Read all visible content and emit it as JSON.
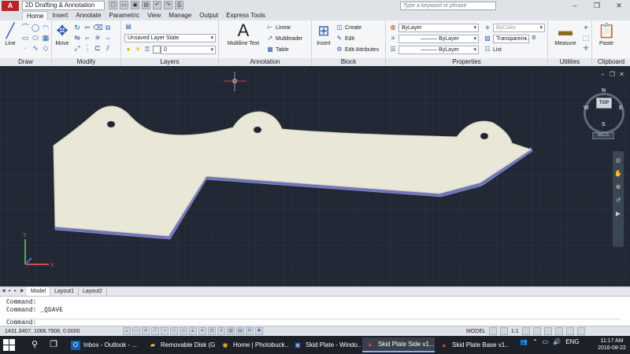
{
  "title_bar": {
    "app_logo": "A",
    "workspace": "2D Drafting & Annotation",
    "search_placeholder": "Type a keyword or phrase",
    "window_buttons": [
      "–",
      "❐",
      "✕"
    ]
  },
  "tabs": [
    {
      "label": "Home",
      "active": true
    },
    {
      "label": "Insert"
    },
    {
      "label": "Annotate"
    },
    {
      "label": "Parametric"
    },
    {
      "label": "View"
    },
    {
      "label": "Manage"
    },
    {
      "label": "Output"
    },
    {
      "label": "Express Tools"
    }
  ],
  "ribbon": {
    "draw": {
      "title": "Draw",
      "line_label": "Line"
    },
    "modify": {
      "title": "Modify",
      "move_label": "Move"
    },
    "layers": {
      "title": "Layers",
      "layer_state": "Unsaved Layer State",
      "current_layer": "0"
    },
    "annotation": {
      "title": "Annotation",
      "multiline_text": "Multiline Text",
      "linear": "Linear",
      "multileader": "Multileader",
      "table": "Table"
    },
    "block": {
      "title": "Block",
      "insert": "Insert",
      "create": "Create",
      "edit": "Edit",
      "edit_attributes": "Edit Attributes"
    },
    "properties": {
      "title": "Properties",
      "color": "ByLayer",
      "linetype": "ByLayer",
      "lineweight": "ByLayer",
      "plot_style": "ByColor",
      "transparency": "Transparen...",
      "transparency_value": "0",
      "list": "List"
    },
    "utilities": {
      "title": "Utilities",
      "measure": "Measure"
    },
    "clipboard": {
      "title": "Clipboard",
      "paste": "Paste"
    }
  },
  "viewcube": {
    "top": "TOP",
    "north": "N",
    "south": "S",
    "east": "E",
    "west": "W",
    "wcs": "WCS"
  },
  "layout_tabs": [
    {
      "label": "Model",
      "active": true
    },
    {
      "label": "Layout1"
    },
    {
      "label": "Layout2"
    }
  ],
  "command_window": {
    "history": [
      "Command:",
      "Command: _QSAVE"
    ],
    "prompt": "Command:"
  },
  "status_bar": {
    "coordinates": "1431.3407, 1066.7908, 0.0000",
    "model_label": "MODEL",
    "scale": "1:1"
  },
  "taskbar": {
    "items": [
      {
        "label": "Inbox - Outlook - ...",
        "icon": "outlook-icon"
      },
      {
        "label": "Removable Disk (G:)",
        "icon": "folder-icon"
      },
      {
        "label": "Home | Photobuck...",
        "icon": "chrome-icon"
      },
      {
        "label": "Skid Plate - Windo...",
        "icon": "photos-icon"
      },
      {
        "label": "Skid Plate Side v1...",
        "icon": "autocad-icon",
        "active": true
      },
      {
        "label": "Skid Plate Base v1...",
        "icon": "autocad-icon"
      }
    ],
    "language": "ENG",
    "time": "11:17 AM",
    "date": "2016-08-22"
  }
}
